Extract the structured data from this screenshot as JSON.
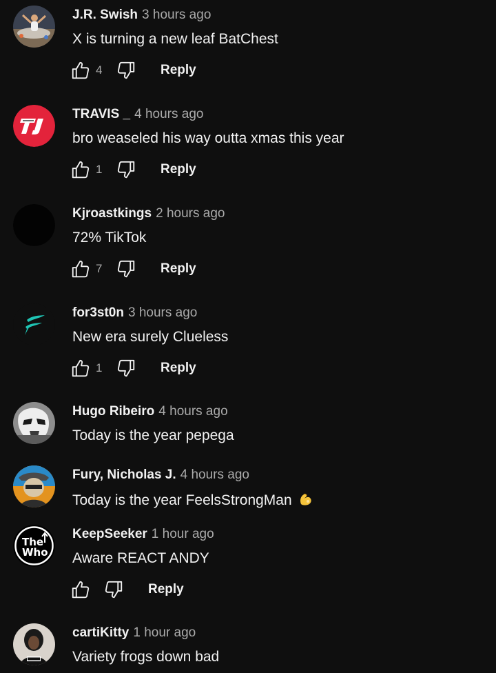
{
  "comments": [
    {
      "author": "J.R. Swish",
      "time": "3 hours ago",
      "text": "X is turning a new leaf BatChest",
      "likes": "4",
      "reply": "Reply",
      "avatar_icon": "basketball-player-avatar"
    },
    {
      "author": "TRAVIS _",
      "time": "4 hours ago",
      "text": "bro weaseled his way outta xmas this year",
      "likes": "1",
      "reply": "Reply",
      "avatar_icon": "tj-logo-avatar"
    },
    {
      "author": "Kjroastkings",
      "time": "2 hours ago",
      "text": "72% TikTok",
      "likes": "7",
      "reply": "Reply",
      "avatar_icon": "black-avatar"
    },
    {
      "author": "for3st0n",
      "time": "3 hours ago",
      "text": "New era surely Clueless",
      "likes": "1",
      "reply": "Reply",
      "avatar_icon": "teal-f-logo-avatar"
    },
    {
      "author": "Hugo Ribeiro",
      "time": "4 hours ago",
      "text": "Today is the year pepega",
      "avatar_icon": "stormtrooper-avatar"
    },
    {
      "author": "Fury, Nicholas J.",
      "time": "4 hours ago",
      "text": "Today is the year FeelsStrongMan",
      "emoji": "flexed-arm-emoji",
      "avatar_icon": "masked-figure-avatar"
    },
    {
      "author": "KeepSeeker",
      "time": "1 hour ago",
      "text": "Aware REACT ANDY",
      "likes": "",
      "reply": "Reply",
      "avatar_icon": "the-who-logo-avatar"
    },
    {
      "author": "cartiKitty",
      "time": "1 hour ago",
      "text": "Variety frogs down bad",
      "avatar_icon": "person-avatar"
    }
  ],
  "colors": {
    "background": "#0f0f0f",
    "primary_text": "#f1f1f1",
    "secondary_text": "#aaaaaa",
    "tj_red": "#e3233b",
    "teal_accent": "#1fc4b4"
  }
}
